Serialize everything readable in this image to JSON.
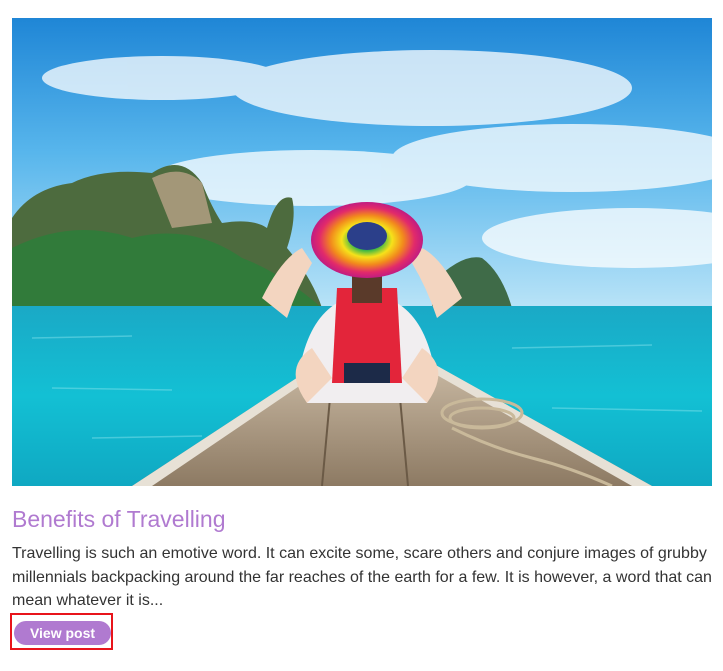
{
  "post": {
    "title": "Benefits of Travelling",
    "excerpt": "Travelling is such an emotive word. It can excite some, scare others and conjure images of grubby millennials backpacking around the far reaches of the earth for a few. It is however, a word that can mean whatever it is...",
    "button_label": "View post"
  },
  "colors": {
    "accent": "#b07ad0",
    "highlight_border": "#e8141b",
    "body_text": "#333333"
  }
}
